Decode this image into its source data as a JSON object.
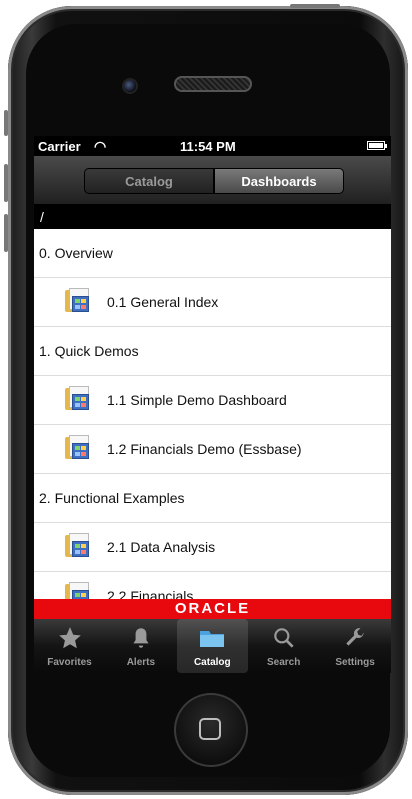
{
  "status": {
    "carrier": "Carrier",
    "time": "11:54 PM"
  },
  "tabs_top": {
    "catalog": "Catalog",
    "dashboards": "Dashboards",
    "selected": "dashboards"
  },
  "path": "/",
  "list": [
    {
      "type": "section",
      "label": "0. Overview"
    },
    {
      "type": "item",
      "label": "0.1 General Index",
      "icon": "dashboard-folder-icon"
    },
    {
      "type": "section",
      "label": "1. Quick Demos"
    },
    {
      "type": "item",
      "label": "1.1 Simple Demo Dashboard",
      "icon": "dashboard-folder-icon"
    },
    {
      "type": "item",
      "label": "1.2 Financials Demo (Essbase)",
      "icon": "dashboard-folder-icon"
    },
    {
      "type": "section",
      "label": "2. Functional Examples"
    },
    {
      "type": "item",
      "label": "2.1 Data Analysis",
      "icon": "dashboard-folder-icon"
    },
    {
      "type": "item",
      "label": "2.2 Financials",
      "icon": "dashboard-folder-icon"
    }
  ],
  "banner": "ORACLE",
  "bottom_tabs": [
    {
      "label": "Favorites",
      "icon": "star-icon"
    },
    {
      "label": "Alerts",
      "icon": "bell-icon"
    },
    {
      "label": "Catalog",
      "icon": "folder-icon",
      "selected": true
    },
    {
      "label": "Search",
      "icon": "search-icon"
    },
    {
      "label": "Settings",
      "icon": "wrench-icon"
    }
  ],
  "colors": {
    "banner": "#e8090f",
    "accent": "#3e6fc3",
    "folder": "#e4b84b"
  }
}
